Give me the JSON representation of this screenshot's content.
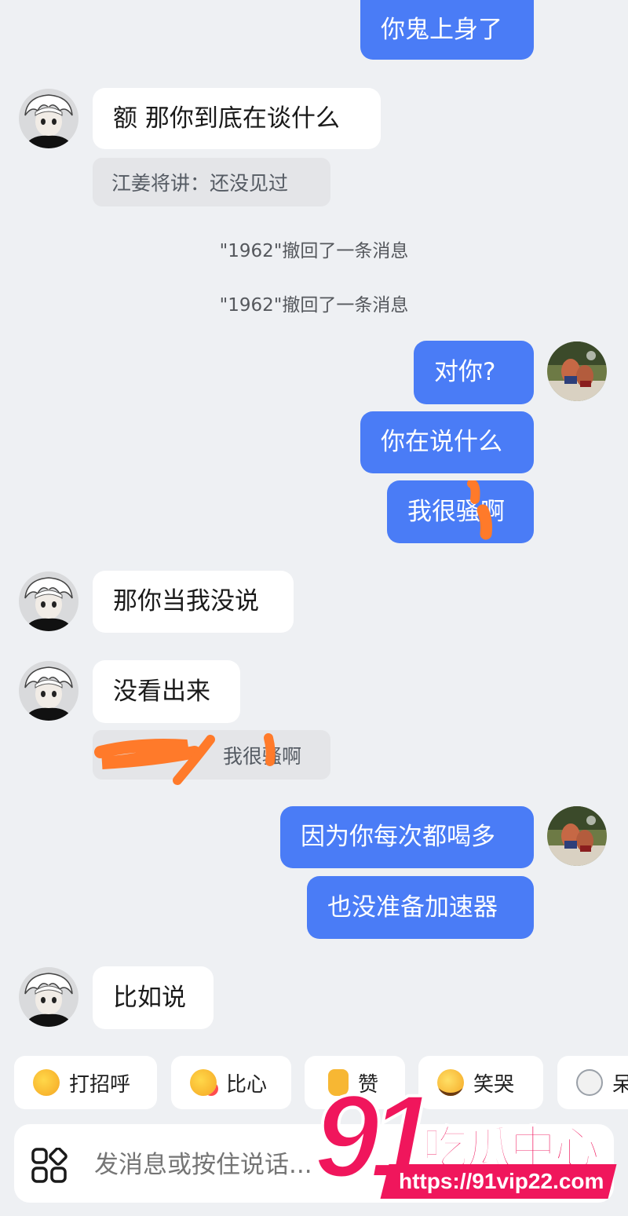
{
  "messages": {
    "m1": "你鬼上身了",
    "m2": "额 那你到底在谈什么",
    "m2_quote": "江姜将讲：还没见过",
    "sys1": "\"1962\"撤回了一条消息",
    "sys2": "\"1962\"撤回了一条消息",
    "m3": "对你?",
    "m4": "你在说什么",
    "m5": "我很骚啊",
    "m6": "那你当我没说",
    "m7": "没看出来",
    "m7_quote": "我很骚啊",
    "m8": "因为你每次都喝多",
    "m9": "也没准备加速器",
    "m10": "比如说"
  },
  "quick_replies": [
    {
      "label": "打招呼",
      "icon": "wave-emoji-icon"
    },
    {
      "label": "比心",
      "icon": "heart-hands-emoji-icon"
    },
    {
      "label": "赞",
      "icon": "thumbs-up-emoji-icon"
    },
    {
      "label": "笑哭",
      "icon": "tears-of-joy-emoji-icon"
    },
    {
      "label": "呆",
      "icon": "cat-face-emoji-icon"
    }
  ],
  "input": {
    "placeholder": "发消息或按住说话..."
  },
  "watermark": {
    "number": "91",
    "title": "吃瓜中心",
    "url": "https://91vip22.com"
  },
  "colors": {
    "background": "#eef0f3",
    "outgoing_bubble": "#4a7cf6",
    "incoming_bubble": "#ffffff",
    "quote_bubble": "#e4e5e8",
    "watermark": "#f0165c",
    "scribble": "#ff7a2a"
  }
}
